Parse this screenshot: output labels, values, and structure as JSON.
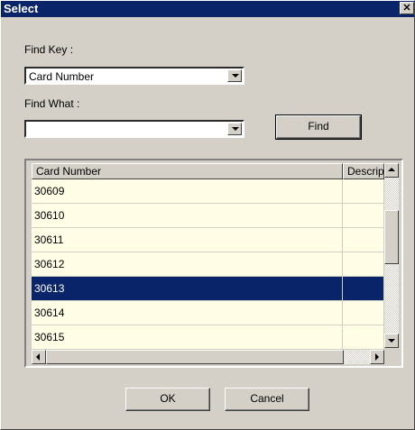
{
  "dialog": {
    "title": "Select",
    "close_glyph": "✕"
  },
  "find_key": {
    "label": "Find Key :",
    "value": "Card Number"
  },
  "find_what": {
    "label": "Find What :",
    "value": ""
  },
  "buttons": {
    "find": "Find",
    "ok": "OK",
    "cancel": "Cancel"
  },
  "grid": {
    "columns": [
      "Card Number",
      "Descrip"
    ],
    "rows": [
      {
        "card": "30609",
        "desc": ""
      },
      {
        "card": "30610",
        "desc": ""
      },
      {
        "card": "30611",
        "desc": ""
      },
      {
        "card": "30612",
        "desc": ""
      },
      {
        "card": "30613",
        "desc": ""
      },
      {
        "card": "30614",
        "desc": ""
      },
      {
        "card": "30615",
        "desc": ""
      }
    ],
    "selected_index": 4
  },
  "colors": {
    "title_bar": "#0a246a",
    "selection": "#0a246a",
    "row_background": "#fffde6",
    "face": "#d4d0c8"
  }
}
